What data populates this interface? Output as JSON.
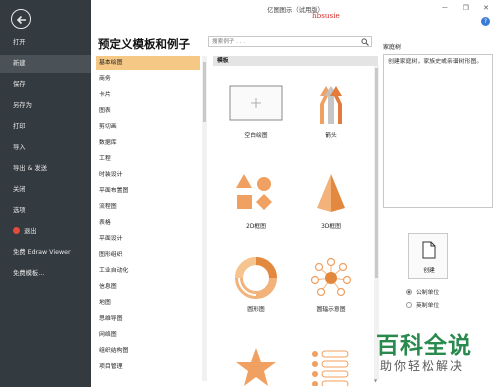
{
  "window": {
    "title": "亿图图示（试用版）",
    "user": "hbsusie",
    "controls": "－ ❐ ✕",
    "help": "?"
  },
  "sidebar": {
    "items": [
      {
        "label": "打开"
      },
      {
        "label": "新建",
        "active": true
      },
      {
        "label": "保存"
      },
      {
        "label": "另存为"
      },
      {
        "label": "打印"
      },
      {
        "label": "导入"
      },
      {
        "label": "导出 & 发送"
      },
      {
        "label": "关闭"
      },
      {
        "label": "选项"
      },
      {
        "label": "退出",
        "icon": "exit-icon"
      },
      {
        "label": "免费 Edraw Viewer"
      },
      {
        "label": "免费模板..."
      }
    ]
  },
  "main": {
    "heading": "预定义模板和例子",
    "search_placeholder": "搜索例子 . . ."
  },
  "categories": [
    {
      "label": "基本绘图",
      "active": true
    },
    {
      "label": "商务"
    },
    {
      "label": "卡片"
    },
    {
      "label": "图表"
    },
    {
      "label": "剪切画"
    },
    {
      "label": "数据库"
    },
    {
      "label": "工程"
    },
    {
      "label": "时装设计"
    },
    {
      "label": "平面布置图"
    },
    {
      "label": "流程图"
    },
    {
      "label": "表格"
    },
    {
      "label": "平面设计"
    },
    {
      "label": "图形组织"
    },
    {
      "label": "工业自动化"
    },
    {
      "label": "信息图"
    },
    {
      "label": "地图"
    },
    {
      "label": "思维导图"
    },
    {
      "label": "网络图"
    },
    {
      "label": "组织结构图"
    },
    {
      "label": "项目管理"
    }
  ],
  "gallery": {
    "header": "模板",
    "templates": [
      {
        "label": "空白绘图",
        "icon": "blank-drawing-icon"
      },
      {
        "label": "箭头",
        "icon": "arrows-icon"
      },
      {
        "label": "2D框图",
        "icon": "2d-block-icon"
      },
      {
        "label": "3D框图",
        "icon": "3d-block-icon"
      },
      {
        "label": "圆形图",
        "icon": "circular-diagram-icon"
      },
      {
        "label": "圆辐示意图",
        "icon": "spoke-diagram-icon"
      },
      {
        "label": "",
        "icon": "star-icon"
      },
      {
        "label": "",
        "icon": "list-icon"
      }
    ]
  },
  "details": {
    "title": "家庭树",
    "description": "创建家庭树，家族史或亲谱树形图。",
    "create_label": "创建",
    "units": [
      {
        "label": "公制单位",
        "checked": true
      },
      {
        "label": "英制单位",
        "checked": false
      }
    ]
  },
  "watermark": {
    "main": "百科全说",
    "sub": "助你轻松解决"
  },
  "colors": {
    "sidebar_bg": "#333a40",
    "selected_category": "#f5c886",
    "accent_orange": "#f0a060",
    "watermark_green": "#2a8a4e"
  }
}
